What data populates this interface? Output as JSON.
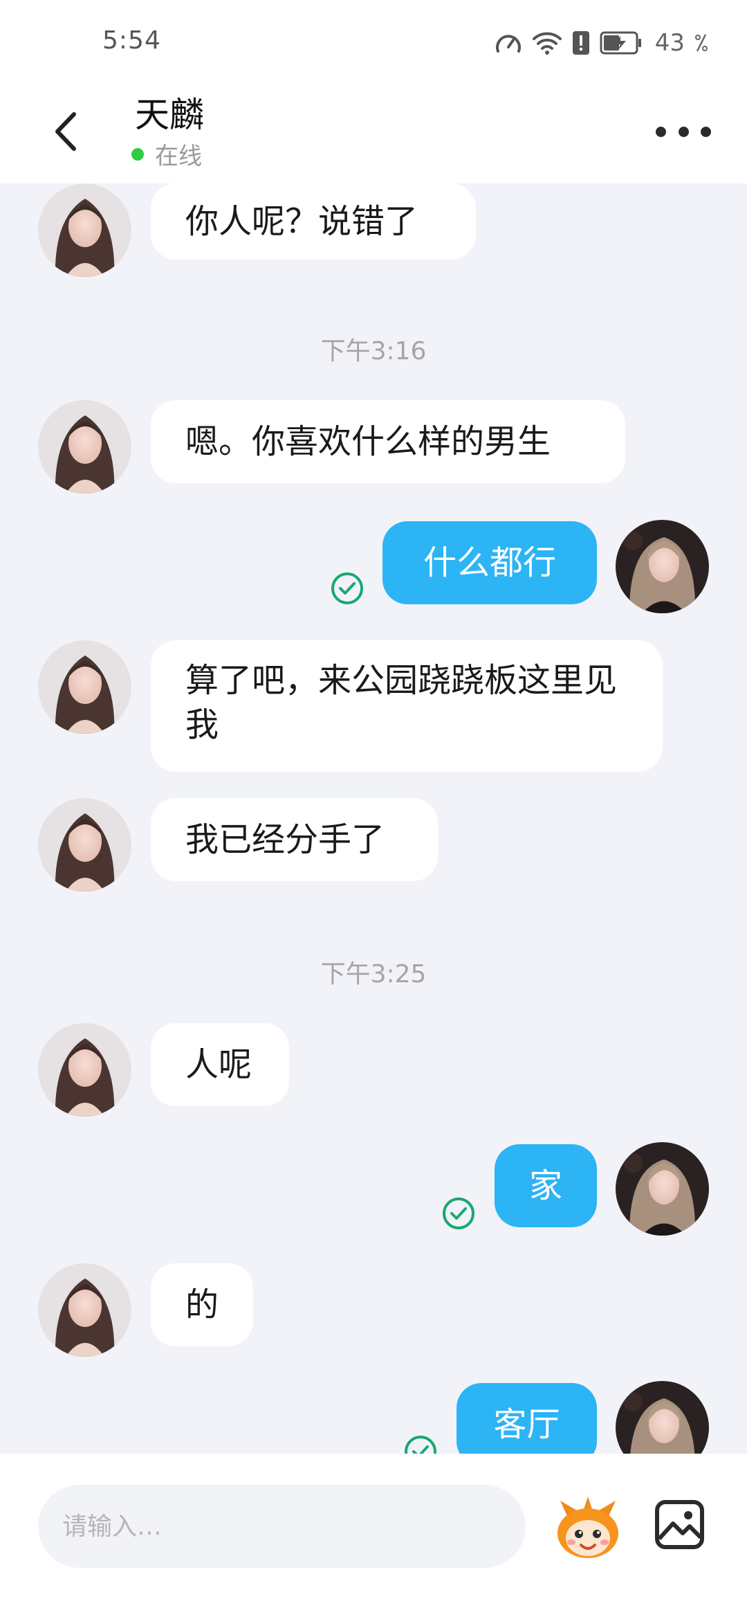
{
  "status_bar": {
    "time": "5:54",
    "battery_percent": "43",
    "icons": [
      "speed-meter-icon",
      "wifi-icon",
      "alert-icon",
      "battery-charging-icon"
    ]
  },
  "header": {
    "back_icon": "chevron-left-icon",
    "contact_name": "天麟",
    "presence": "在线",
    "presence_color": "#2ecc40",
    "more_icon": "more-dots-icon"
  },
  "colors": {
    "outgoing_bubble": "#2db4f5",
    "incoming_bubble": "#ffffff",
    "chat_background": "#f2f3f8",
    "read_check": "#19a870"
  },
  "messages": [
    {
      "dir": "in",
      "text": "你人呢？说错了"
    },
    {
      "type": "time",
      "text": "下午3:16"
    },
    {
      "dir": "in",
      "text": "嗯。你喜欢什么样的男生"
    },
    {
      "dir": "out",
      "text": "什么都行",
      "read": true
    },
    {
      "dir": "in",
      "text": "算了吧，来公园跷跷板这里见我"
    },
    {
      "dir": "in",
      "text": "我已经分手了"
    },
    {
      "type": "time",
      "text": "下午3:25"
    },
    {
      "dir": "in",
      "text": "人呢"
    },
    {
      "dir": "out",
      "text": "家",
      "read": true
    },
    {
      "dir": "in",
      "text": "的"
    },
    {
      "dir": "out",
      "text": "客厅",
      "read": true
    }
  ],
  "input": {
    "placeholder": "请输入…",
    "value": "",
    "emoji_icon": "mascot-emoji-icon",
    "image_icon": "image-icon"
  }
}
